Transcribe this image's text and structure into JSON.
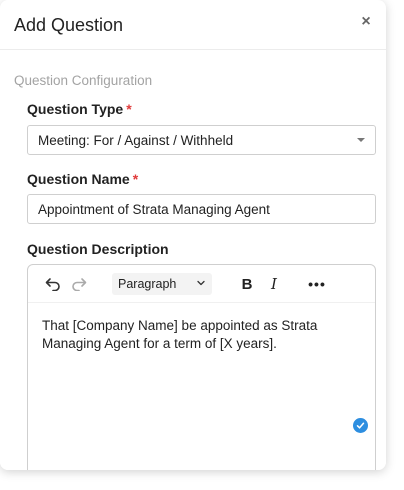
{
  "modal": {
    "title": "Add Question",
    "close_symbol": "×"
  },
  "section": {
    "title": "Question Configuration"
  },
  "question_type": {
    "label": "Question Type",
    "required_mark": "*",
    "selected_value": "Meeting: For / Against / Withheld"
  },
  "question_name": {
    "label": "Question Name",
    "required_mark": "*",
    "value": "Appointment of Strata Managing Agent"
  },
  "question_description": {
    "label": "Question Description",
    "toolbar": {
      "undo_icon": "undo-icon",
      "redo_icon": "redo-icon",
      "block_format": "Paragraph",
      "bold_label": "B",
      "italic_label": "I",
      "more_label": "•••"
    },
    "content": "That [Company Name] be appointed as Strata Managing Agent for a term of [X years].",
    "status_path": "p"
  },
  "colors": {
    "required": "#e03a3a",
    "accent": "#2d8ee0",
    "section_title": "#a3a3a3"
  }
}
